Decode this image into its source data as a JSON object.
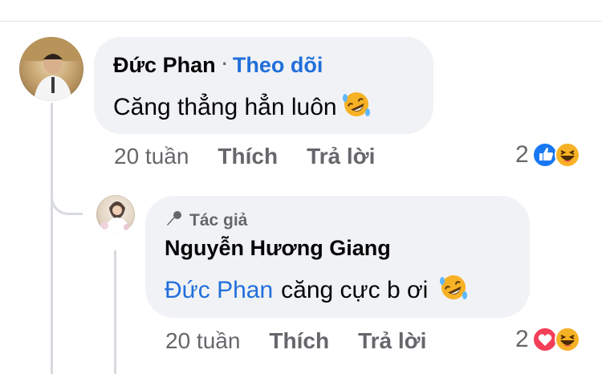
{
  "comment": {
    "author": "Đức Phan",
    "separator": "·",
    "follow_label": "Theo dõi",
    "text": "Căng thẳng hẳn luôn",
    "text_emoji": "rolling-on-floor-laughing-emoji",
    "time": "20 tuần",
    "like_label": "Thích",
    "reply_label": "Trả lời",
    "reaction_count": "2",
    "reactions": [
      "like-reaction-icon",
      "haha-reaction-icon"
    ]
  },
  "reply": {
    "badge_label": "Tác giả",
    "author": "Nguyễn Hương Giang",
    "mention": "Đức Phan",
    "text": "căng cực b ơi",
    "text_emoji": "rolling-on-floor-laughing-emoji",
    "time": "20 tuần",
    "like_label": "Thích",
    "reply_label": "Trả lời",
    "reaction_count": "2",
    "reactions": [
      "love-reaction-icon",
      "haha-reaction-icon"
    ]
  },
  "colors": {
    "bubble": "#f0f2f5",
    "link_blue": "#216fdb",
    "muted": "#65676b",
    "like_blue": "#1877f2",
    "love_red": "#f33e58",
    "haha_yellow": "#f7b125"
  }
}
